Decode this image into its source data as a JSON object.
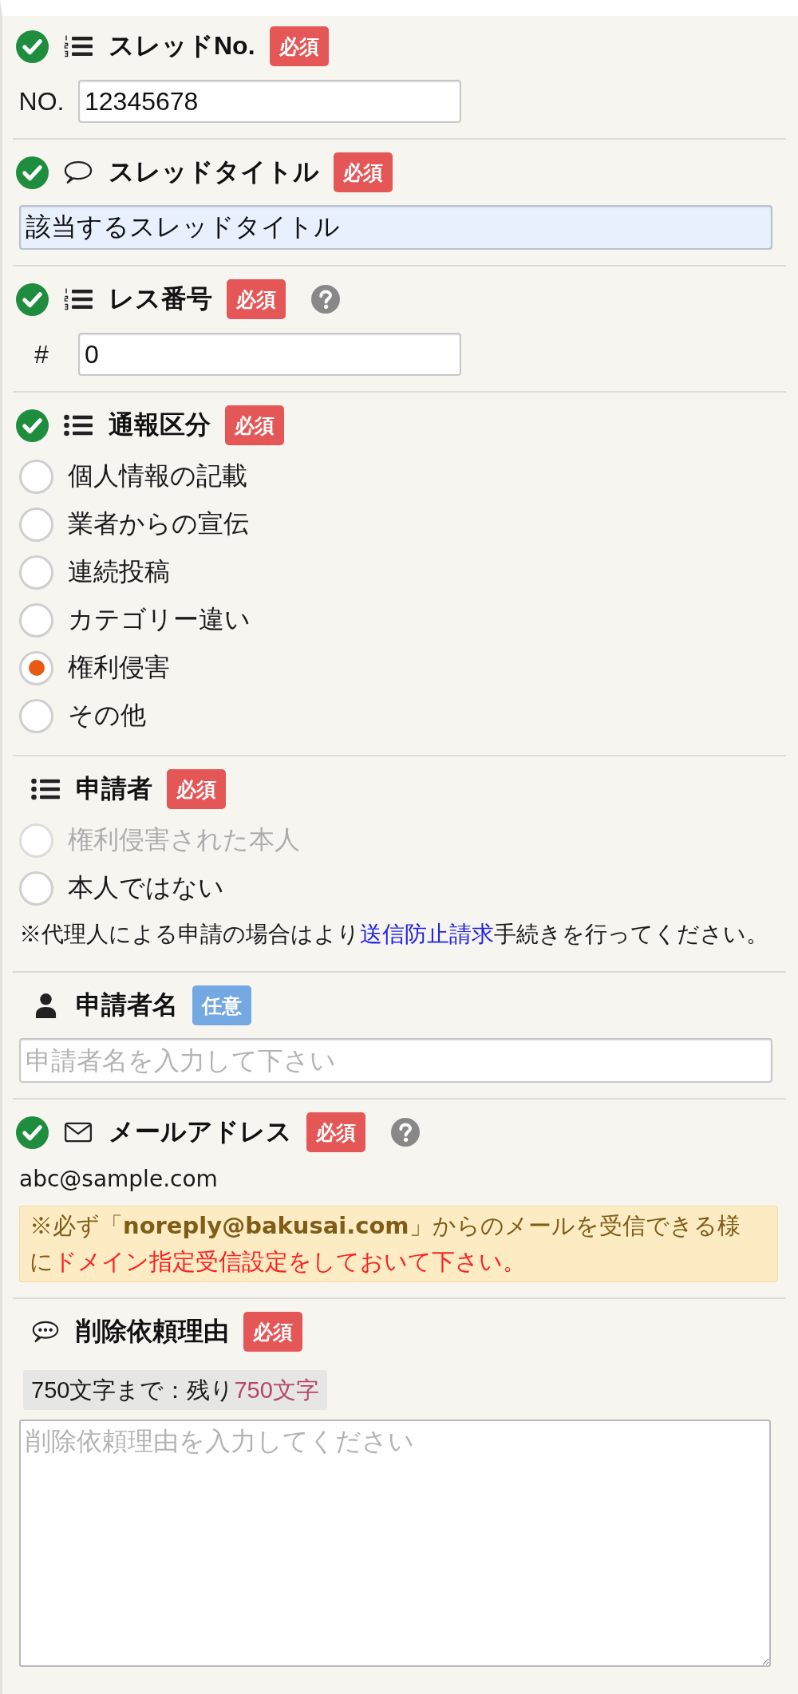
{
  "sections": [
    {
      "kind": "number",
      "valid": true,
      "title": "スレッドNo.",
      "badge": {
        "text": "必須",
        "required": true
      },
      "prefix": "NO.",
      "value": "12345678"
    },
    {
      "kind": "text",
      "valid": true,
      "title": "スレッドタイトル",
      "badge": {
        "text": "必須",
        "required": true
      },
      "value": "該当するスレッドタイトル",
      "autofilled": true
    },
    {
      "kind": "number",
      "valid": true,
      "title": "レス番号",
      "badge": {
        "text": "必須",
        "required": true
      },
      "help": true,
      "prefix": "#",
      "value": "0"
    },
    {
      "kind": "choice",
      "valid": true,
      "title": "通報区分",
      "badge": {
        "text": "必須",
        "required": true
      },
      "options": [
        {
          "label": "個人情報の記載",
          "selected": false,
          "disabled": false
        },
        {
          "label": "業者からの宣伝",
          "selected": false,
          "disabled": false
        },
        {
          "label": "連続投稿",
          "selected": false,
          "disabled": false
        },
        {
          "label": "カテゴリー違い",
          "selected": false,
          "disabled": false
        },
        {
          "label": "権利侵害",
          "selected": true,
          "disabled": false
        },
        {
          "label": "その他",
          "selected": false,
          "disabled": false
        }
      ]
    },
    {
      "kind": "choice",
      "valid": false,
      "title": "申請者",
      "badge": {
        "text": "必須",
        "required": true
      },
      "options": [
        {
          "label": "権利侵害された本人",
          "selected": false,
          "disabled": true
        },
        {
          "label": "本人ではない",
          "selected": false,
          "disabled": false
        }
      ],
      "note": {
        "before": "※代理人による申請の場合はより",
        "link": "送信防止請求",
        "after": "手続きを行ってください。"
      }
    },
    {
      "kind": "name",
      "valid": false,
      "title": "申請者名",
      "badge": {
        "text": "任意",
        "required": false
      },
      "placeholder": "申請者名を入力して下さい",
      "autofilled": false
    },
    {
      "kind": "email",
      "valid": true,
      "title": "メールアドレス",
      "badge": {
        "text": "必須",
        "required": true
      },
      "help": true,
      "value": "abc@sample.com",
      "notice": {
        "text": "※必ず「**noreply@bakusai.com**」からのメールを受信できる様に",
        "alert": "ドメイン指定受信設定をしておいて下さい。"
      }
    },
    {
      "kind": "message",
      "valid": false,
      "title": "削除依頼理由",
      "badge": {
        "text": "必須",
        "required": true
      },
      "counter": {
        "text": "750文字まで：残り",
        "remaining": "750文字"
      },
      "placeholder": "削除依頼理由を入力してください"
    }
  ]
}
